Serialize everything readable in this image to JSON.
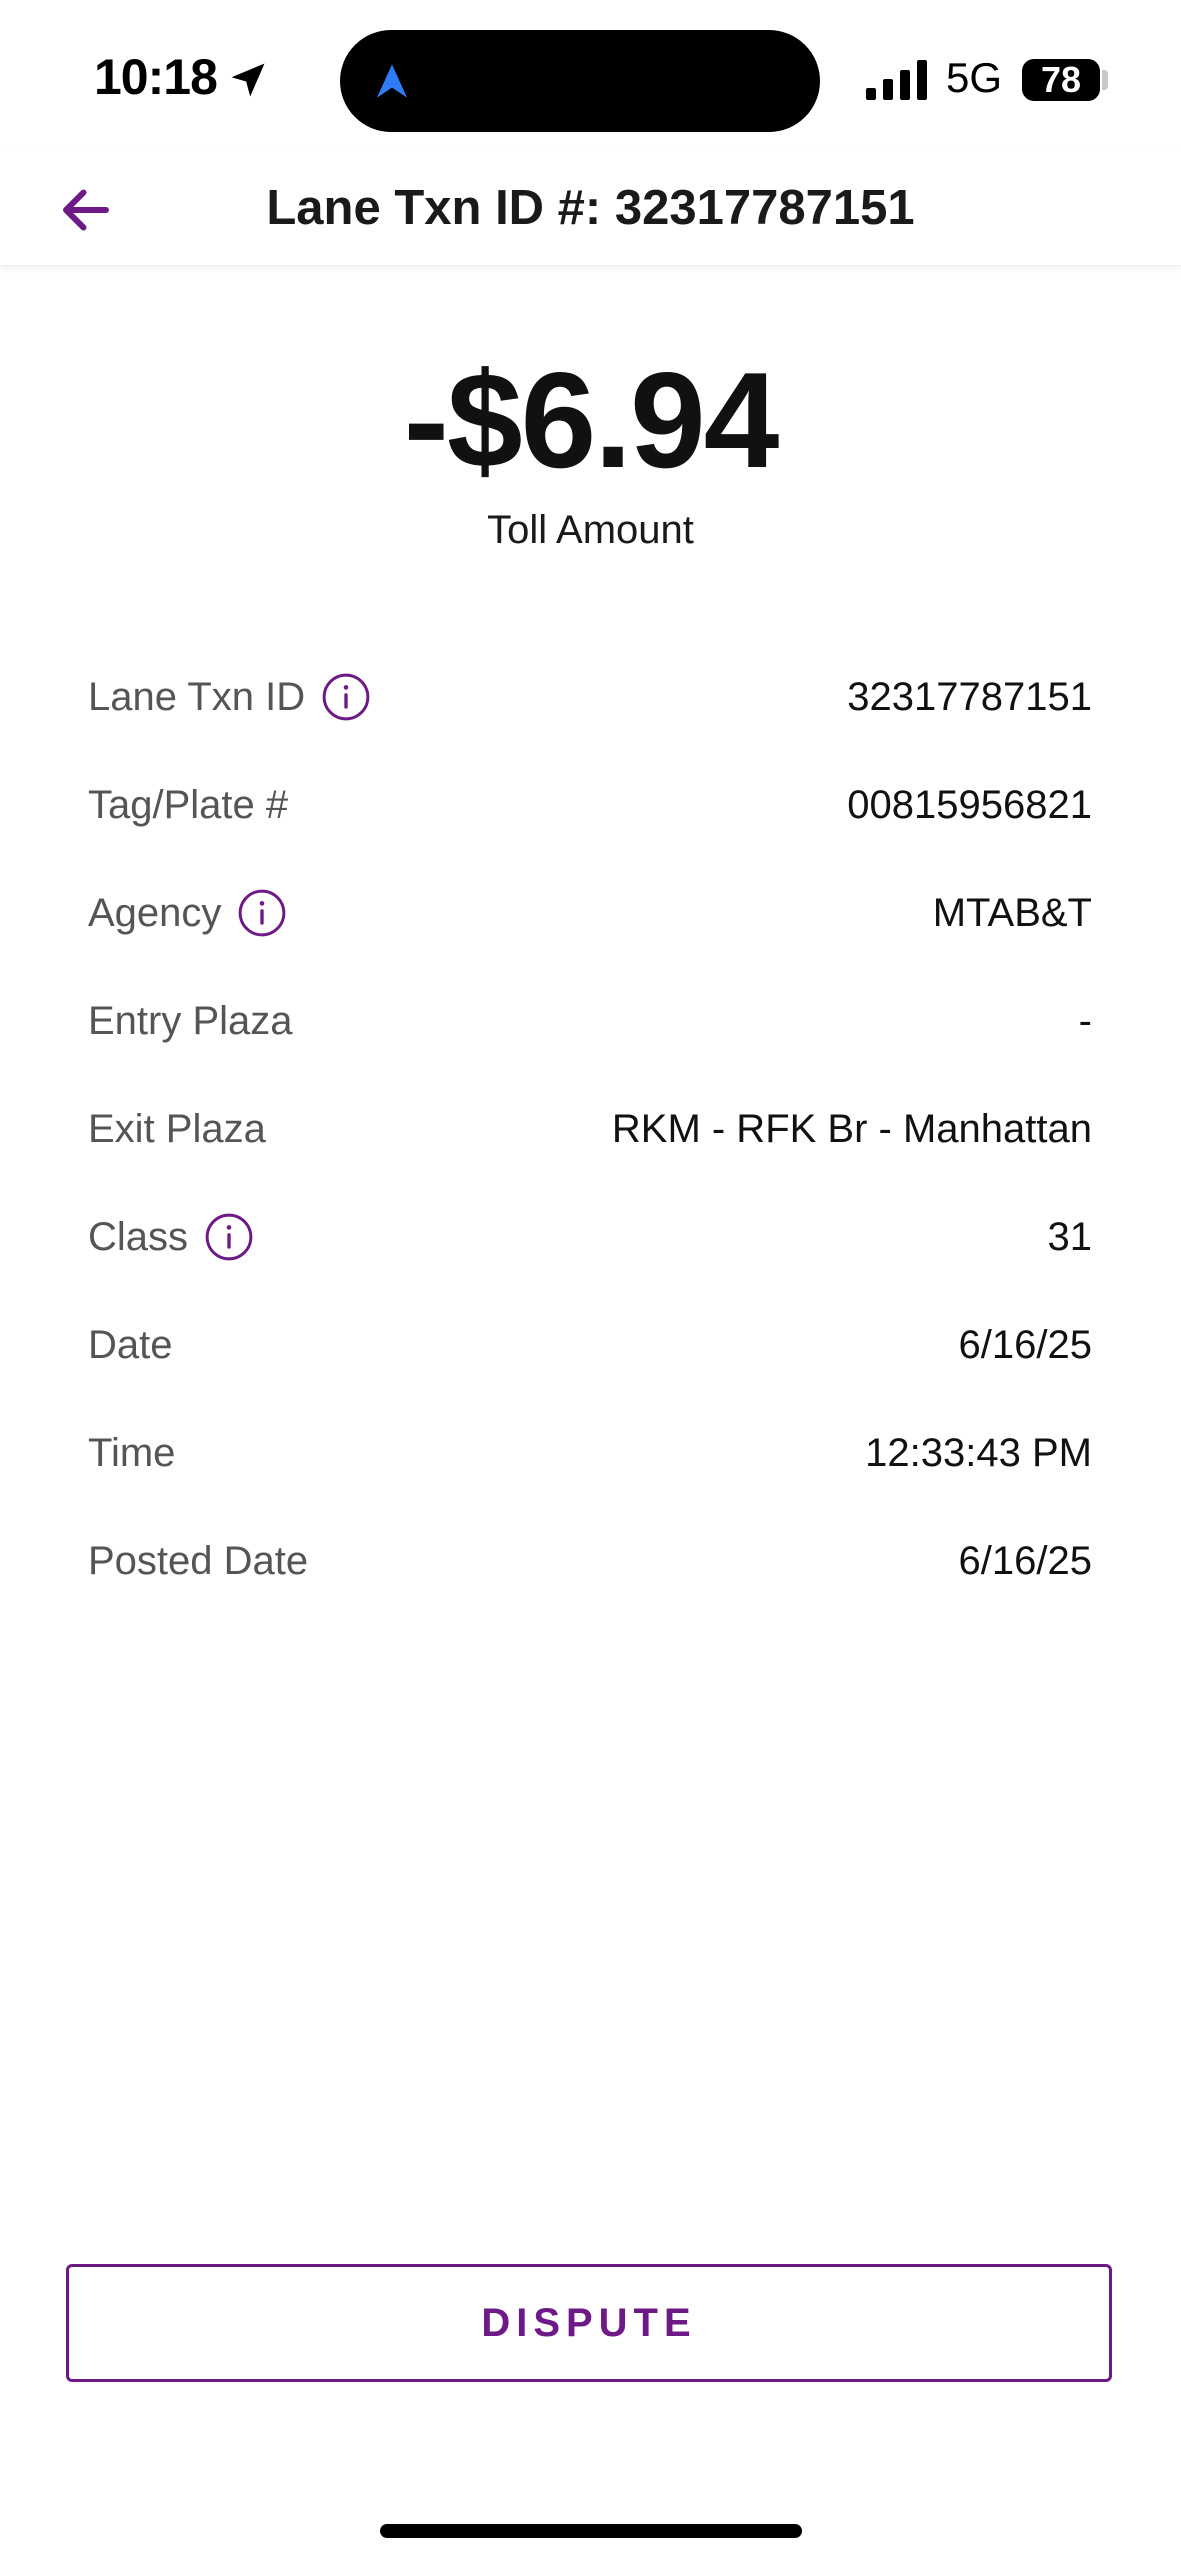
{
  "status_bar": {
    "time": "10:18",
    "network": "5G",
    "battery": "78"
  },
  "header": {
    "title": "Lane Txn ID #: 32317787151",
    "back_icon": "arrow-left-icon"
  },
  "toll": {
    "amount": "-$6.94",
    "label": "Toll Amount"
  },
  "details": [
    {
      "label": "Lane Txn ID",
      "value": "32317787151",
      "info": true
    },
    {
      "label": "Tag/Plate #",
      "value": "00815956821",
      "info": false
    },
    {
      "label": "Agency",
      "value": "MTAB&T",
      "info": true
    },
    {
      "label": "Entry Plaza",
      "value": "-",
      "info": false
    },
    {
      "label": "Exit Plaza",
      "value": "RKM - RFK Br - Manhattan",
      "info": false
    },
    {
      "label": "Class",
      "value": "31",
      "info": true
    },
    {
      "label": "Date",
      "value": "6/16/25",
      "info": false
    },
    {
      "label": "Time",
      "value": "12:33:43 PM",
      "info": false
    },
    {
      "label": "Posted Date",
      "value": "6/16/25",
      "info": false
    }
  ],
  "actions": {
    "dispute_label": "DISPUTE"
  },
  "colors": {
    "accent": "#6e1a86",
    "label_gray": "#555555",
    "island_arrow": "#2f7cf6"
  }
}
